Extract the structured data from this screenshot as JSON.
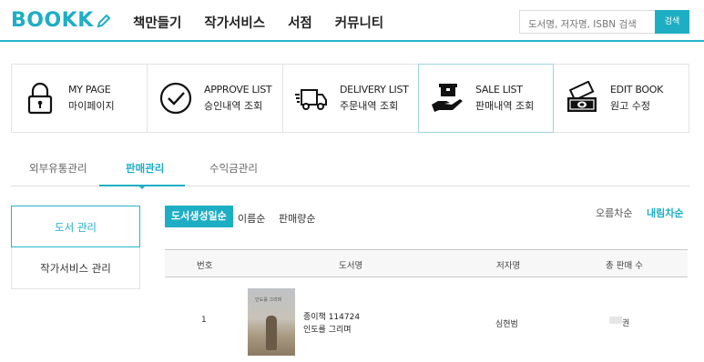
{
  "header": {
    "logo": "BOOKK",
    "nav": [
      "책만들기",
      "작가서비스",
      "서점",
      "커뮤니티"
    ],
    "search_placeholder": "도서명, 저자명, ISBN 검색",
    "search_button": "검색"
  },
  "menu": [
    {
      "en": "MY PAGE",
      "ko": "마이페이지",
      "icon": "locked-padlock-icon"
    },
    {
      "en": "APPROVE LIST",
      "ko": "승인내역 조회",
      "icon": "check-circle-icon"
    },
    {
      "en": "DELIVERY LIST",
      "ko": "주문내역 조회",
      "icon": "delivery-truck-icon"
    },
    {
      "en": "SALE LIST",
      "ko": "판매내역 조회",
      "icon": "hand-with-box-icon"
    },
    {
      "en": "EDIT BOOK",
      "ko": "원고 수정",
      "icon": "money-bills-icon"
    }
  ],
  "subtabs": [
    "외부유통관리",
    "판매관리",
    "수익금관리"
  ],
  "side_menu": [
    "도서 관리",
    "작가서비스 관리"
  ],
  "sort": {
    "active": "도서생성일순",
    "options": [
      "이름순",
      "판매량순"
    ],
    "order_asc": "오름차순",
    "order_desc": "내림차순"
  },
  "table": {
    "headers": [
      "번호",
      "도서명",
      "저자명",
      "총 판매 수"
    ],
    "rows": [
      {
        "number": "1",
        "cover_title": "인도를 그리며",
        "title_line1": "종이책 114724",
        "title_line2": "인도를 그리며",
        "author": "심현범",
        "sales_suffix": "권"
      }
    ]
  },
  "colors": {
    "accent": "#1eaec4"
  }
}
